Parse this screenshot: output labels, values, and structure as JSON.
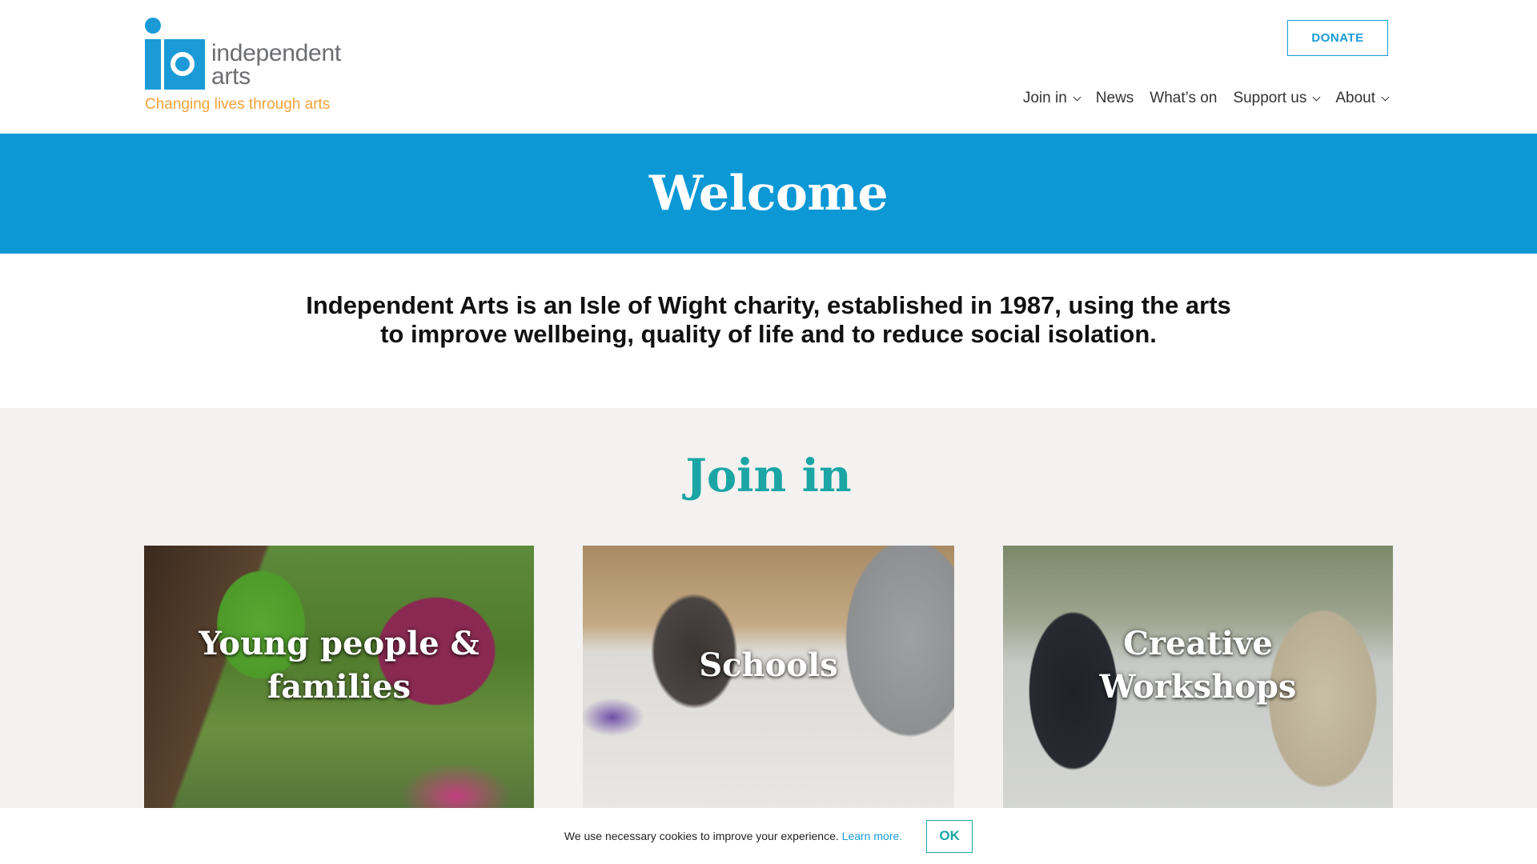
{
  "brand": {
    "word_line1": "independent",
    "word_line2": "arts",
    "tagline": "Changing lives through arts",
    "colors": {
      "blue": "#1a9bd7",
      "orange": "#f0a23a",
      "grey": "#6d6e71",
      "teal": "#1ba5a5"
    }
  },
  "header": {
    "donate_label": "DONATE",
    "nav": [
      {
        "label": "Join in",
        "has_dropdown": true
      },
      {
        "label": "News",
        "has_dropdown": false
      },
      {
        "label": "What’s on",
        "has_dropdown": false
      },
      {
        "label": "Support us",
        "has_dropdown": true
      },
      {
        "label": "About",
        "has_dropdown": true
      }
    ]
  },
  "welcome": {
    "title": "Welcome",
    "background": "#0c98d5"
  },
  "intro": {
    "text": "Independent Arts is an Isle of Wight charity, established in 1987, using the arts to improve wellbeing, quality of life and to reduce social isolation."
  },
  "join": {
    "title": "Join in",
    "cards": [
      {
        "title": "Young people & families"
      },
      {
        "title": "Schools"
      },
      {
        "title": "Creative Workshops"
      }
    ]
  },
  "cookie": {
    "text": "We use necessary cookies to improve your experience.",
    "link": "Learn more.",
    "ok_label": "OK"
  }
}
